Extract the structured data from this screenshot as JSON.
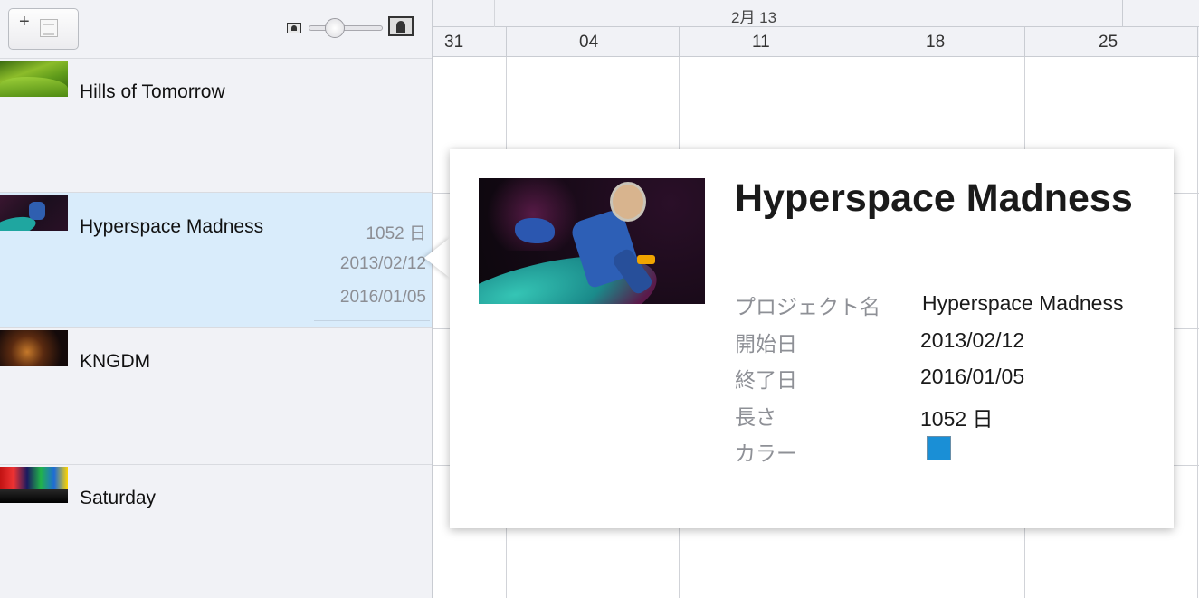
{
  "toolbar": {
    "add_button_label": "+",
    "zoom_value_percent": 30
  },
  "projects": [
    {
      "name": "Hills of Tomorrow"
    },
    {
      "name": "Hyperspace Madness",
      "length": "1052 日",
      "start": "2013/02/12",
      "end": "2016/01/05"
    },
    {
      "name": "KNGDM"
    },
    {
      "name": "Saturday"
    }
  ],
  "timeline": {
    "month": "2月 13",
    "weeks": [
      "31",
      "04",
      "11",
      "18",
      "25"
    ]
  },
  "popover": {
    "title": "Hyperspace Madness",
    "labels": {
      "project_name": "プロジェクト名",
      "start_date": "開始日",
      "end_date": "終了日",
      "length": "長さ",
      "color": "カラー"
    },
    "values": {
      "project_name": "Hyperspace Madness",
      "start_date": "2013/02/12",
      "end_date": "2016/01/05",
      "length": "1052 日",
      "color": "#1a8fd6"
    }
  }
}
